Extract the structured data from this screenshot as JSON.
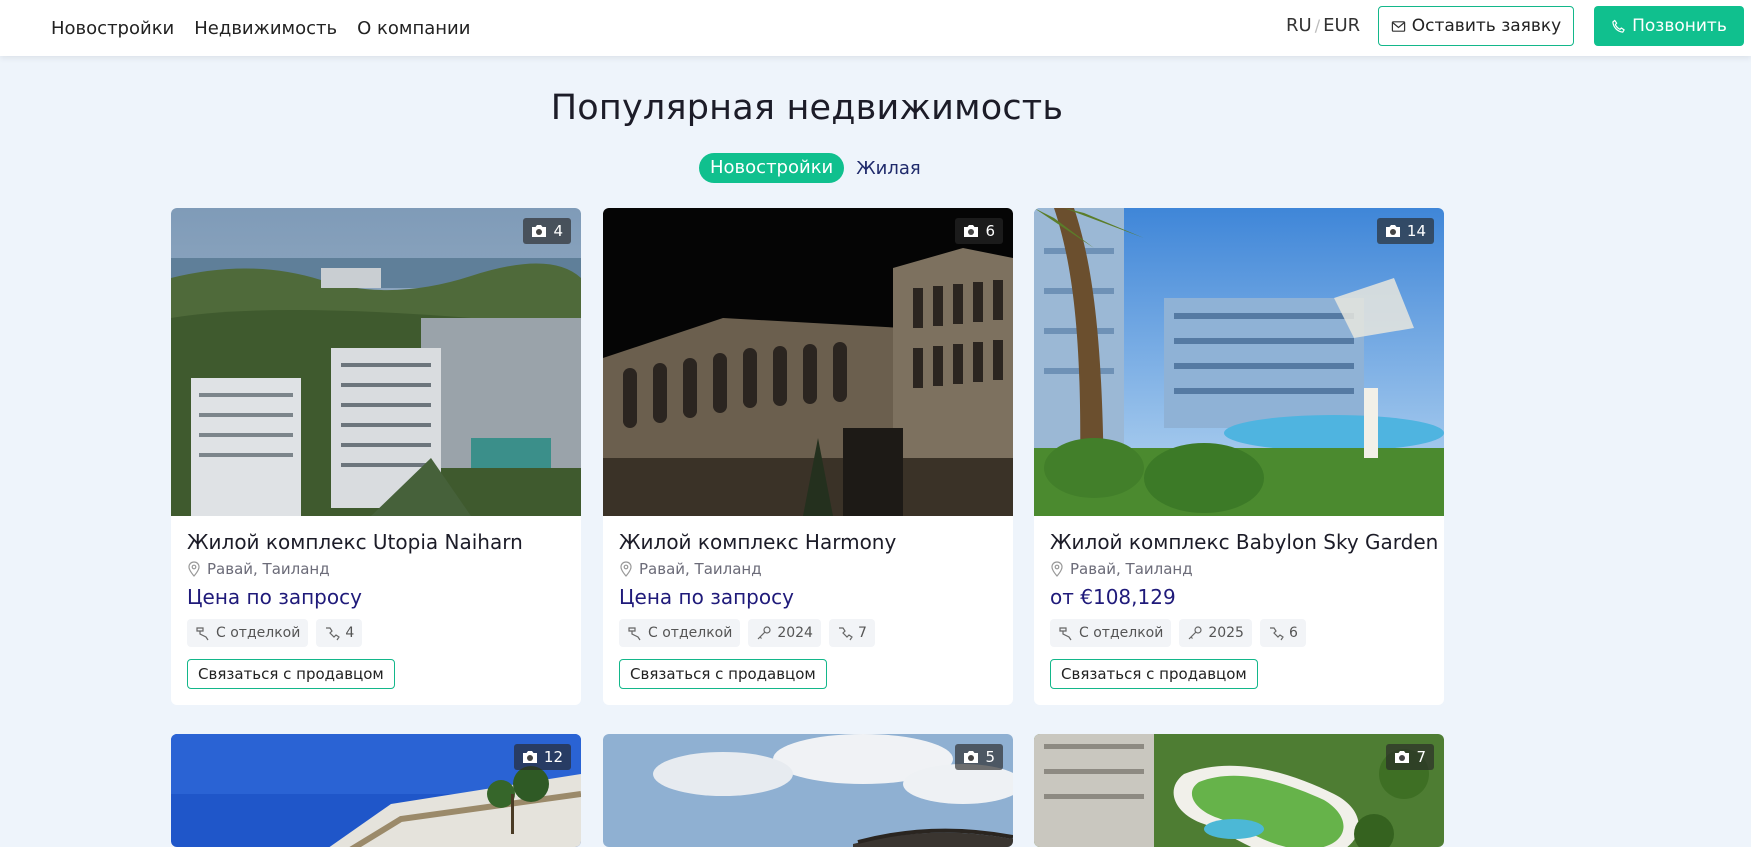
{
  "header": {
    "nav": [
      "Новостройки",
      "Недвижимость",
      "О компании"
    ],
    "lang": "RU",
    "currency": "EUR",
    "request_button": "Оставить заявку",
    "call_button": "Позвонить"
  },
  "section": {
    "title": "Популярная недвижимость",
    "tabs": [
      {
        "label": "Новостройки",
        "active": true
      },
      {
        "label": "Жилая",
        "active": false
      }
    ]
  },
  "cards": [
    {
      "photo_count": "4",
      "title": "Жилой комплекс Utopia Naiharn",
      "location": "Равай, Таиланд",
      "price": "Цена по запросу",
      "tags": [
        {
          "icon": "finishing-icon",
          "label": "С отделкой"
        },
        {
          "icon": "rooms-icon",
          "label": "4"
        }
      ],
      "contact": "Связаться с продавцом"
    },
    {
      "photo_count": "6",
      "title": "Жилой комплекс Harmony",
      "location": "Равай, Таиланд",
      "price": "Цена по запросу",
      "tags": [
        {
          "icon": "finishing-icon",
          "label": "С отделкой"
        },
        {
          "icon": "key-icon",
          "label": "2024"
        },
        {
          "icon": "rooms-icon",
          "label": "7"
        }
      ],
      "contact": "Связаться с продавцом"
    },
    {
      "photo_count": "14",
      "title": "Жилой комплекс Babylon Sky Garden II",
      "location": "Равай, Таиланд",
      "price": "от €108,129",
      "tags": [
        {
          "icon": "finishing-icon",
          "label": "С отделкой"
        },
        {
          "icon": "key-icon",
          "label": "2025"
        },
        {
          "icon": "rooms-icon",
          "label": "6"
        }
      ],
      "contact": "Связаться с продавцом"
    },
    {
      "photo_count": "12"
    },
    {
      "photo_count": "5"
    },
    {
      "photo_count": "7"
    }
  ],
  "colors": {
    "accent": "#10c08e",
    "price": "#1f1a7a",
    "background": "#eef4fb"
  }
}
